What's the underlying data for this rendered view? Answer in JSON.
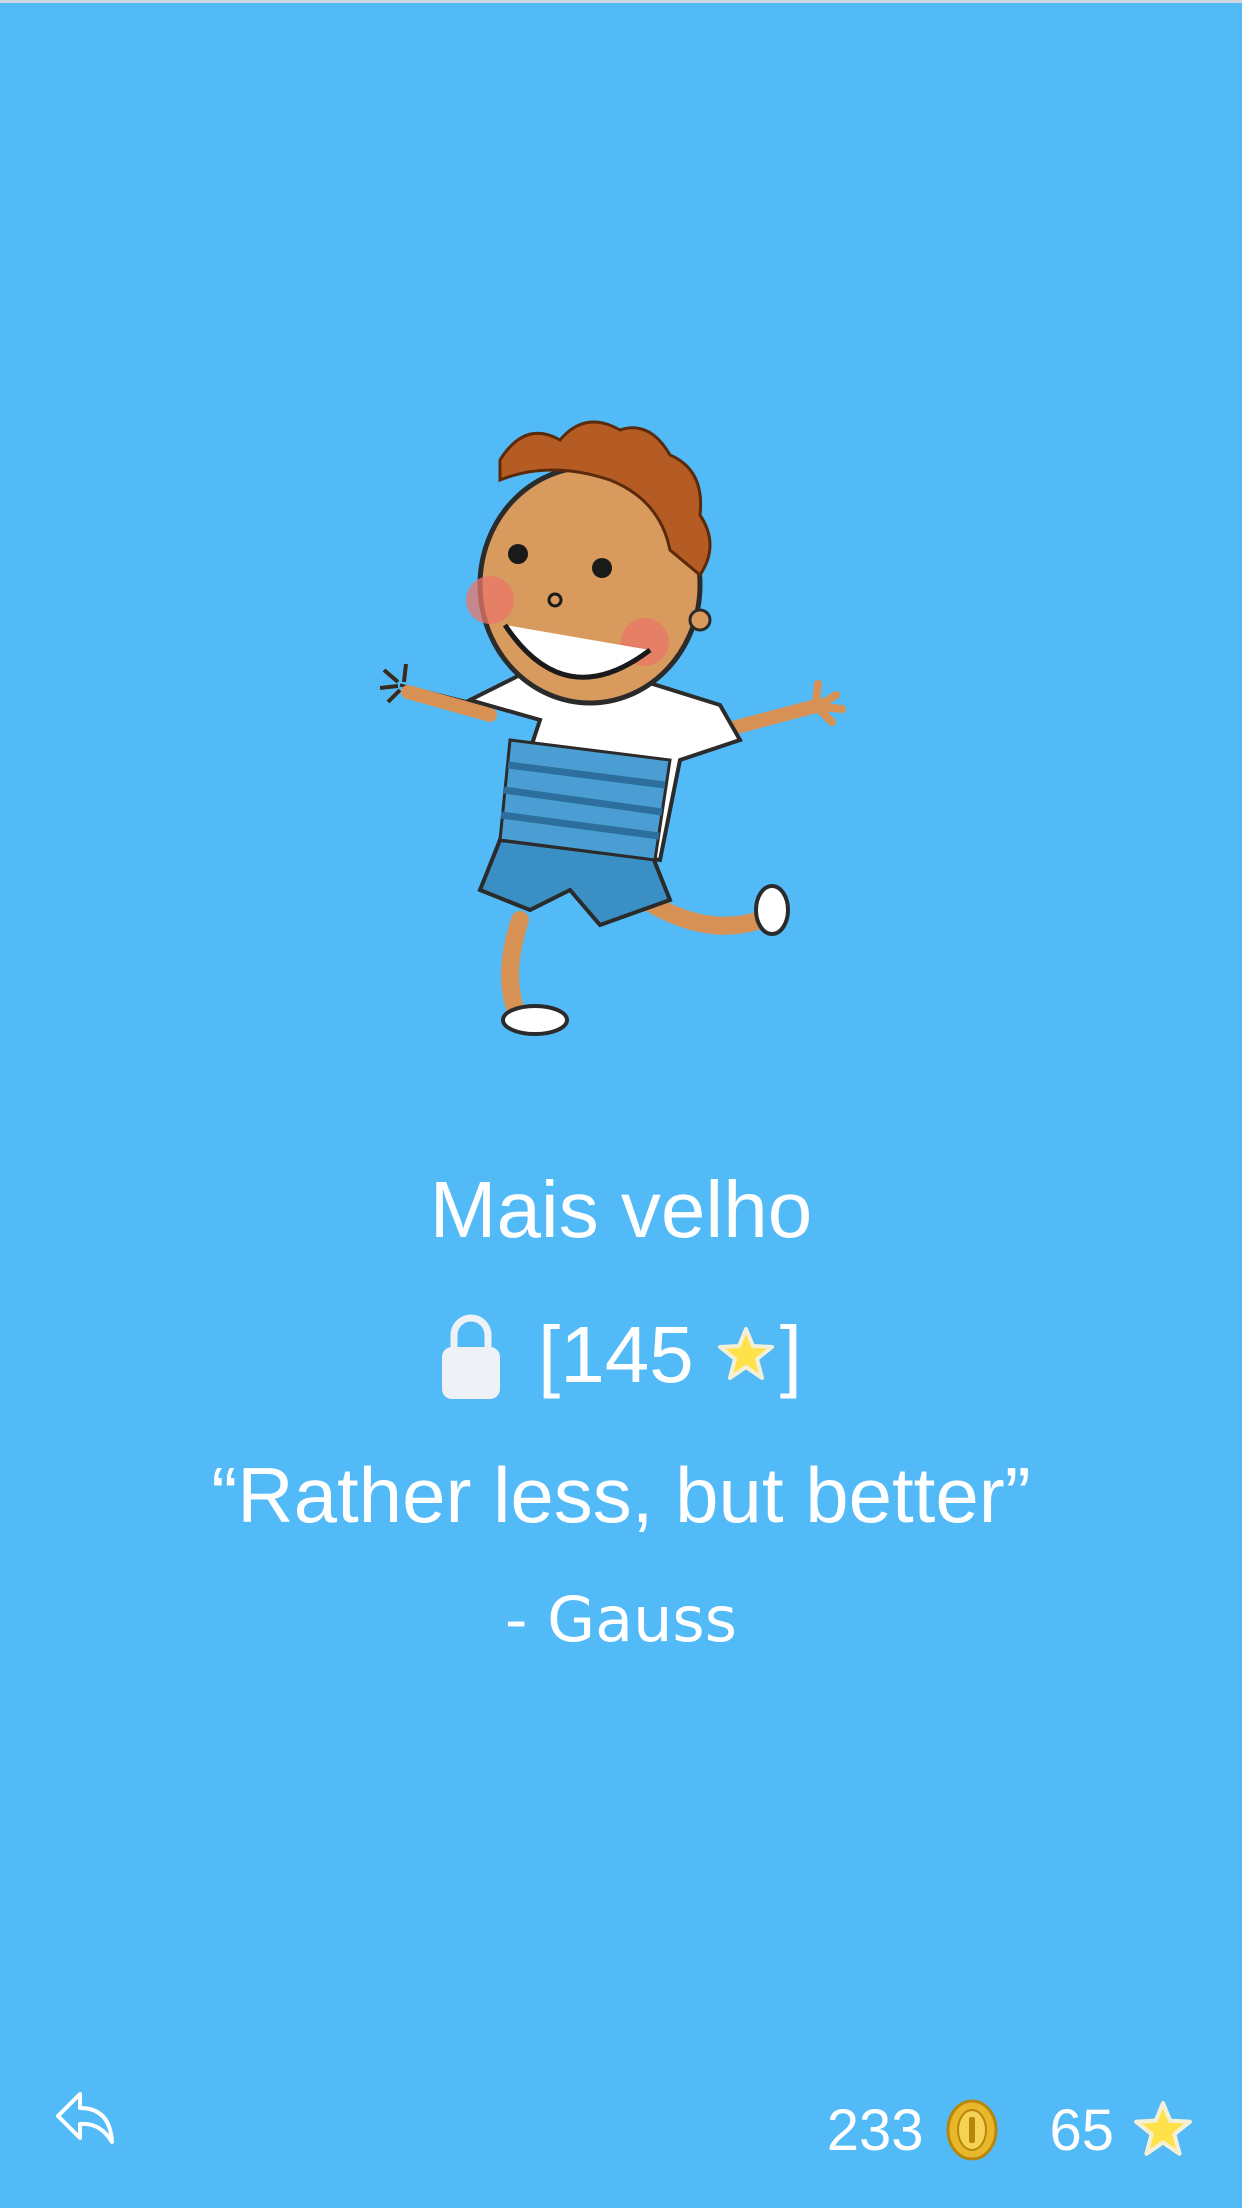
{
  "level": {
    "title": "Mais velho",
    "price_open": "[",
    "price_value": "145",
    "price_close": "]",
    "quote": "“Rather less, but better”",
    "author": "- Gauss"
  },
  "footer": {
    "coins": "233",
    "stars": "65"
  },
  "icons": {
    "lock": "lock-icon",
    "star": "star-icon",
    "coin": "coin-icon",
    "back": "back-arrow-icon"
  },
  "colors": {
    "background": "#53baf8",
    "text": "#ffffff",
    "star": "#ffe24a",
    "coin": "#e8b82a"
  }
}
